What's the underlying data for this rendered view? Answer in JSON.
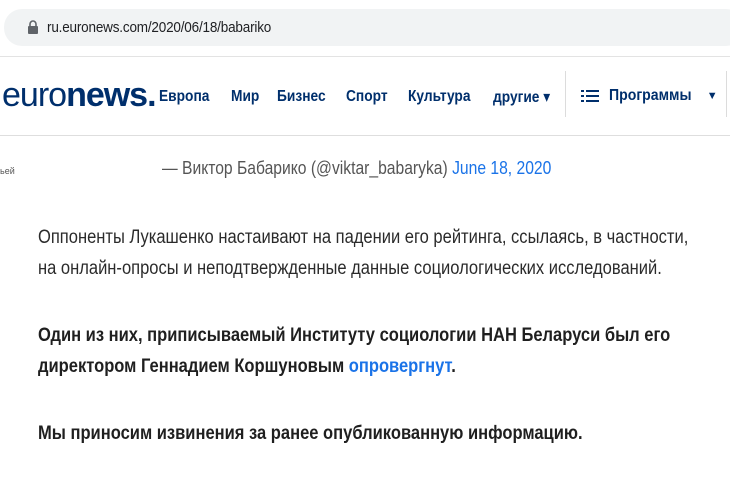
{
  "browser": {
    "url": "ru.euronews.com/2020/06/18/babariko"
  },
  "nav": {
    "logo_part1": "euro",
    "logo_part2": "news.",
    "items": [
      "Европа",
      "Мир",
      "Бизнес",
      "Спорт",
      "Культура",
      "другие ▾"
    ],
    "programs_label": "Программы",
    "programs_caret": "▼"
  },
  "left_fragment": "ьей",
  "article": {
    "attribution_prefix": "— Виктор Бабарико (@viktar_babaryka) ",
    "attribution_date": "June 18, 2020",
    "paragraph1": "Оппоненты Лукашенко настаивают на падении его рейтинга, ссылаясь, в частности, на онлайн-опросы и неподтвержденные данные социологических исследований.",
    "paragraph2_text": "Один из них, приписываемый Институту социологии НАН Беларуси был его директором Геннадием Коршуновым ",
    "paragraph2_link": "опровергнут",
    "paragraph2_end": ".",
    "paragraph3": "Мы приносим извинения за ранее опубликованную информацию."
  },
  "colors": {
    "brand": "#002f6c",
    "link": "#1a73e8"
  }
}
